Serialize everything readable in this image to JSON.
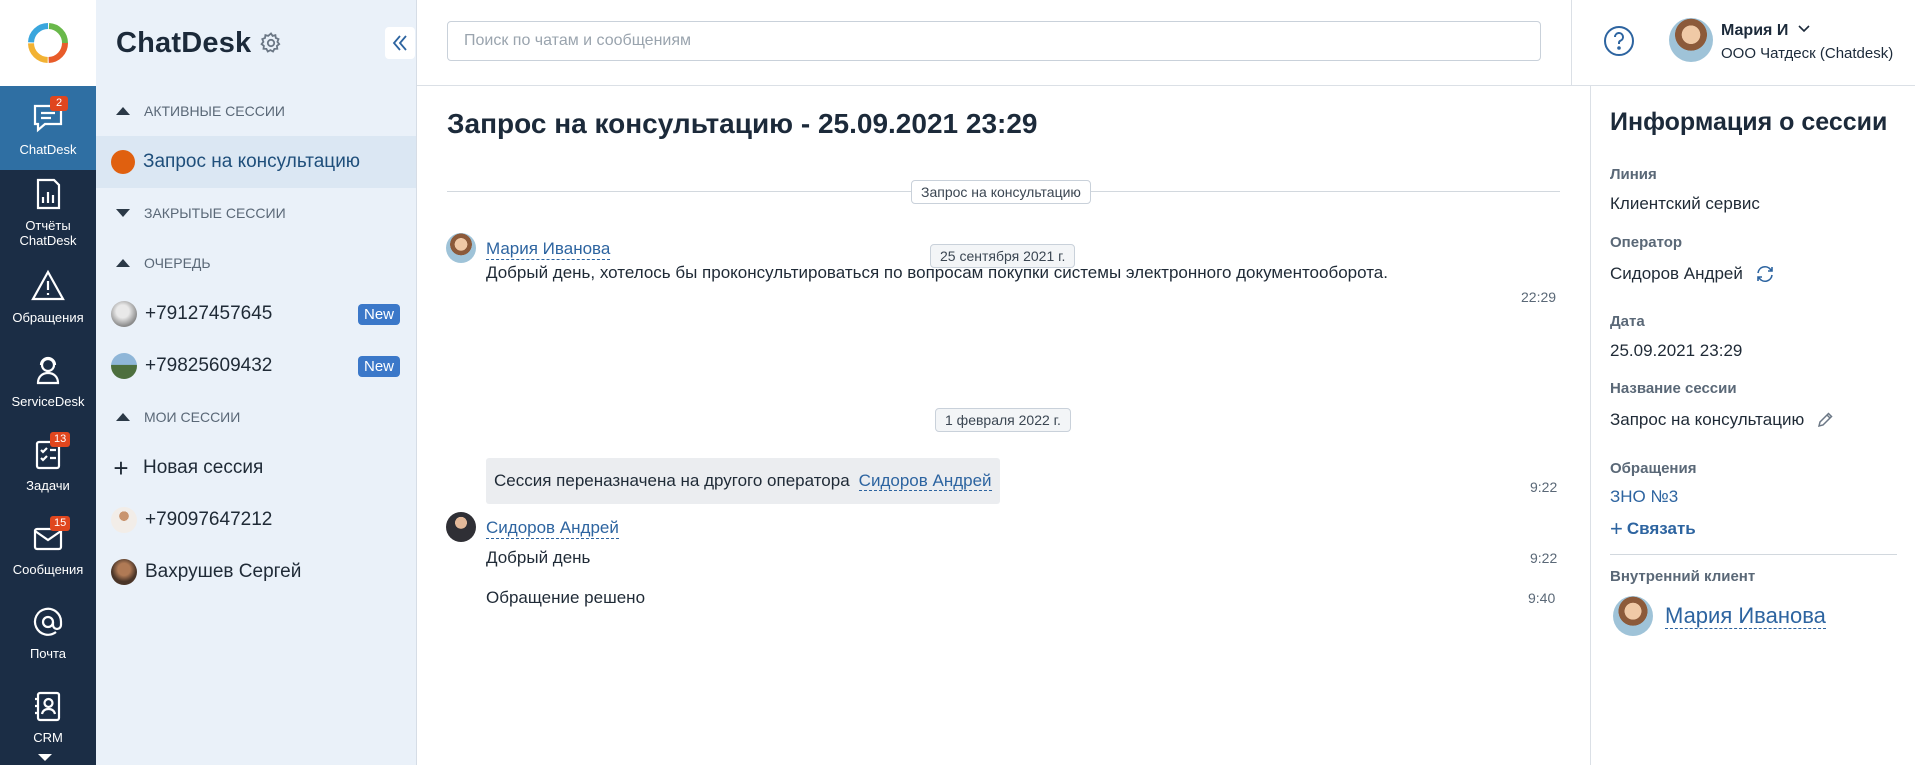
{
  "app": {
    "name": "ChatDesk"
  },
  "rail": {
    "items": [
      {
        "label": "ChatDesk",
        "badge": "2"
      },
      {
        "label": "Отчёты ChatDesk",
        "badge": ""
      },
      {
        "label": "Обращения",
        "badge": ""
      },
      {
        "label": "ServiceDesk",
        "badge": ""
      },
      {
        "label": "Задачи",
        "badge": "13"
      },
      {
        "label": "Сообщения",
        "badge": "15"
      },
      {
        "label": "Почта",
        "badge": ""
      },
      {
        "label": "CRM",
        "badge": ""
      }
    ]
  },
  "sessions_panel": {
    "title": "ChatDesk",
    "sections": {
      "active": "Активные сессии",
      "closed": "Закрытые сессии",
      "queue": "Очередь",
      "mine": "Мои сессии"
    },
    "active_items": [
      {
        "label": "Запрос на консультацию"
      }
    ],
    "queue_items": [
      {
        "label": "+79127457645",
        "badge": "New"
      },
      {
        "label": "+79825609432",
        "badge": "New"
      }
    ],
    "new_session_label": "Новая сессия",
    "my_items": [
      {
        "label": "+79097647212"
      },
      {
        "label": "Вахрушев Сергей"
      }
    ]
  },
  "topbar": {
    "search_placeholder": "Поиск по чатам и сообщениям",
    "user_name": "Мария И",
    "user_org": "ООО Чатдеск (Chatdesk)"
  },
  "chat": {
    "title": "Запрос на консультацию - 25.09.2021 23:29",
    "session_pill": "Запрос на консультацию",
    "date1": "25 сентября 2021 г.",
    "date2": "1 февраля 2022 г.",
    "messages": [
      {
        "author": "Мария Иванова",
        "text": "Добрый день, хотелось бы проконсультироваться по вопросам покупки системы электронного документооборота.",
        "time": "22:29"
      },
      {
        "system_text": "Сессия переназначена на другого оператора",
        "system_link": "Сидоров Андрей",
        "time": "9:22"
      },
      {
        "author": "Сидоров Андрей",
        "text": "Добрый день",
        "time": "9:22"
      },
      {
        "text": "Обращение решено",
        "time": "9:40"
      }
    ]
  },
  "info": {
    "title": "Информация о сессии",
    "line_label": "Линия",
    "line_value": "Клиентский сервис",
    "operator_label": "Оператор",
    "operator_value": "Сидоров Андрей",
    "date_label": "Дата",
    "date_value": "25.09.2021 23:29",
    "name_label": "Название сессии",
    "name_value": "Запрос на консультацию",
    "appeals_label": "Обращения",
    "appeal_link": "ЗНО №3",
    "bind_label": "Связать",
    "client_label": "Внутренний клиент",
    "client_name": "Мария Иванова"
  },
  "colors": {
    "rail_bg": "#1b2d45",
    "rail_active": "#2f6fa3",
    "panel_bg": "#eaf1f9",
    "accent_link": "#2d64a0",
    "badge_red": "#e0461e",
    "badge_new": "#3b78c9",
    "active_dot": "#e0600f"
  }
}
